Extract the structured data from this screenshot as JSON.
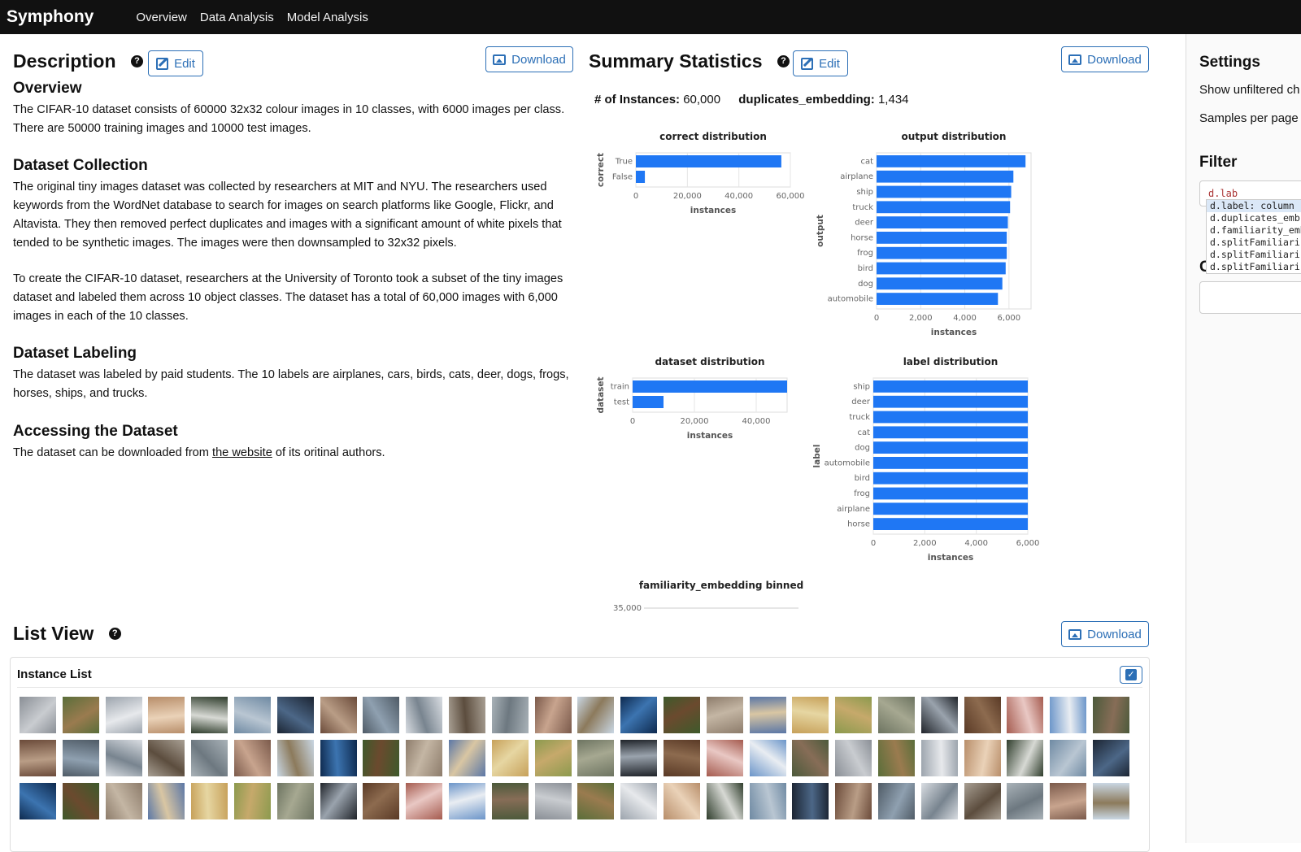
{
  "nav": {
    "brand": "Symphony",
    "items": [
      "Overview",
      "Data Analysis",
      "Model Analysis"
    ]
  },
  "description": {
    "title": "Description",
    "edit_label": "Edit",
    "download_label": "Download",
    "sections": [
      {
        "heading": "Overview",
        "paragraphs": [
          "The CIFAR-10 dataset consists of 60000 32x32 colour images in 10 classes, with 6000 images per class. There are 50000 training images and 10000 test images."
        ]
      },
      {
        "heading": "Dataset Collection",
        "paragraphs": [
          "The original tiny images dataset was collected by researchers at MIT and NYU. The researchers used keywords from the WordNet database to search for images on search platforms like Google, Flickr, and Altavista. They then removed perfect duplicates and images with a significant amount of white pixels that tended to be synthetic images. The images were then downsampled to 32x32 pixels.",
          "To create the CIFAR-10 dataset, researchers at the University of Toronto took a subset of the tiny images dataset and labeled them across 10 object classes. The dataset has a total of 60,000 images with 6,000 images in each of the 10 classes."
        ]
      },
      {
        "heading": "Dataset Labeling",
        "paragraphs": [
          "The dataset was labeled by paid students. The 10 labels are airplanes, cars, birds, cats, deer, dogs, frogs, horses, ships, and trucks."
        ]
      },
      {
        "heading": "Accessing the Dataset",
        "paragraphs": []
      }
    ],
    "access_prefix": "The dataset can be downloaded from ",
    "access_link": "the website",
    "access_suffix": " of its oritinal authors."
  },
  "summary": {
    "title": "Summary Statistics",
    "edit_label": "Edit",
    "download_label": "Download",
    "instances_label": "# of Instances:",
    "instances_value": "60,000",
    "duplicates_label": "duplicates_embedding:",
    "duplicates_value": "1,434"
  },
  "chart_data": [
    {
      "type": "bar",
      "orientation": "horizontal",
      "title": "correct distribution",
      "ylabel": "correct",
      "xlabel": "instances",
      "categories": [
        "True",
        "False"
      ],
      "values": [
        56500,
        3500
      ],
      "xlim": [
        0,
        60000
      ],
      "ticks": [
        "0",
        "20,000",
        "40,000",
        "60,000"
      ],
      "color": "#1f77f4"
    },
    {
      "type": "bar",
      "orientation": "horizontal",
      "title": "output distribution",
      "ylabel": "output",
      "xlabel": "instances",
      "categories": [
        "cat",
        "airplane",
        "ship",
        "truck",
        "deer",
        "horse",
        "frog",
        "bird",
        "dog",
        "automobile"
      ],
      "values": [
        6750,
        6200,
        6100,
        6050,
        5950,
        5900,
        5900,
        5850,
        5700,
        5500
      ],
      "xlim": [
        0,
        7000
      ],
      "ticks": [
        "0",
        "2,000",
        "4,000",
        "6,000"
      ],
      "color": "#1f77f4"
    },
    {
      "type": "bar",
      "orientation": "horizontal",
      "title": "dataset distribution",
      "ylabel": "dataset",
      "xlabel": "instances",
      "categories": [
        "train",
        "test"
      ],
      "values": [
        50000,
        10000
      ],
      "xlim": [
        0,
        50000
      ],
      "ticks": [
        "0",
        "20,000",
        "40,000"
      ],
      "color": "#1f77f4"
    },
    {
      "type": "bar",
      "orientation": "horizontal",
      "title": "label distribution",
      "ylabel": "label",
      "xlabel": "instances",
      "categories": [
        "ship",
        "deer",
        "truck",
        "cat",
        "dog",
        "automobile",
        "bird",
        "frog",
        "airplane",
        "horse"
      ],
      "values": [
        6000,
        6000,
        6000,
        6000,
        6000,
        6000,
        6000,
        6000,
        6000,
        6000
      ],
      "xlim": [
        0,
        6000
      ],
      "ticks": [
        "0",
        "2,000",
        "4,000",
        "6,000"
      ],
      "color": "#1f77f4"
    },
    {
      "type": "bar",
      "title": "familiarity_embedding binned",
      "ytick_top": "35,000"
    }
  ],
  "list_view": {
    "title": "List View",
    "download_label": "Download",
    "instance_list_label": "Instance List",
    "thumbnail_rows": 3,
    "thumbnail_cols": 26
  },
  "settings": {
    "title": "Settings",
    "show_unfiltered": "Show unfiltered ch",
    "samples_per_page": "Samples per page",
    "filter_title": "Filter",
    "filter_value": "d.lab",
    "autocomplete": [
      "d.label: column",
      "d.duplicates_emb",
      "d.familiarity_emb",
      "d.splitFamiliari",
      "d.splitFamiliari",
      "d.splitFamiliari"
    ],
    "second_heading_fragment": "C"
  },
  "colors": {
    "accent": "#2c6fb6",
    "bar": "#1f77f4",
    "topbar": "#111111"
  }
}
